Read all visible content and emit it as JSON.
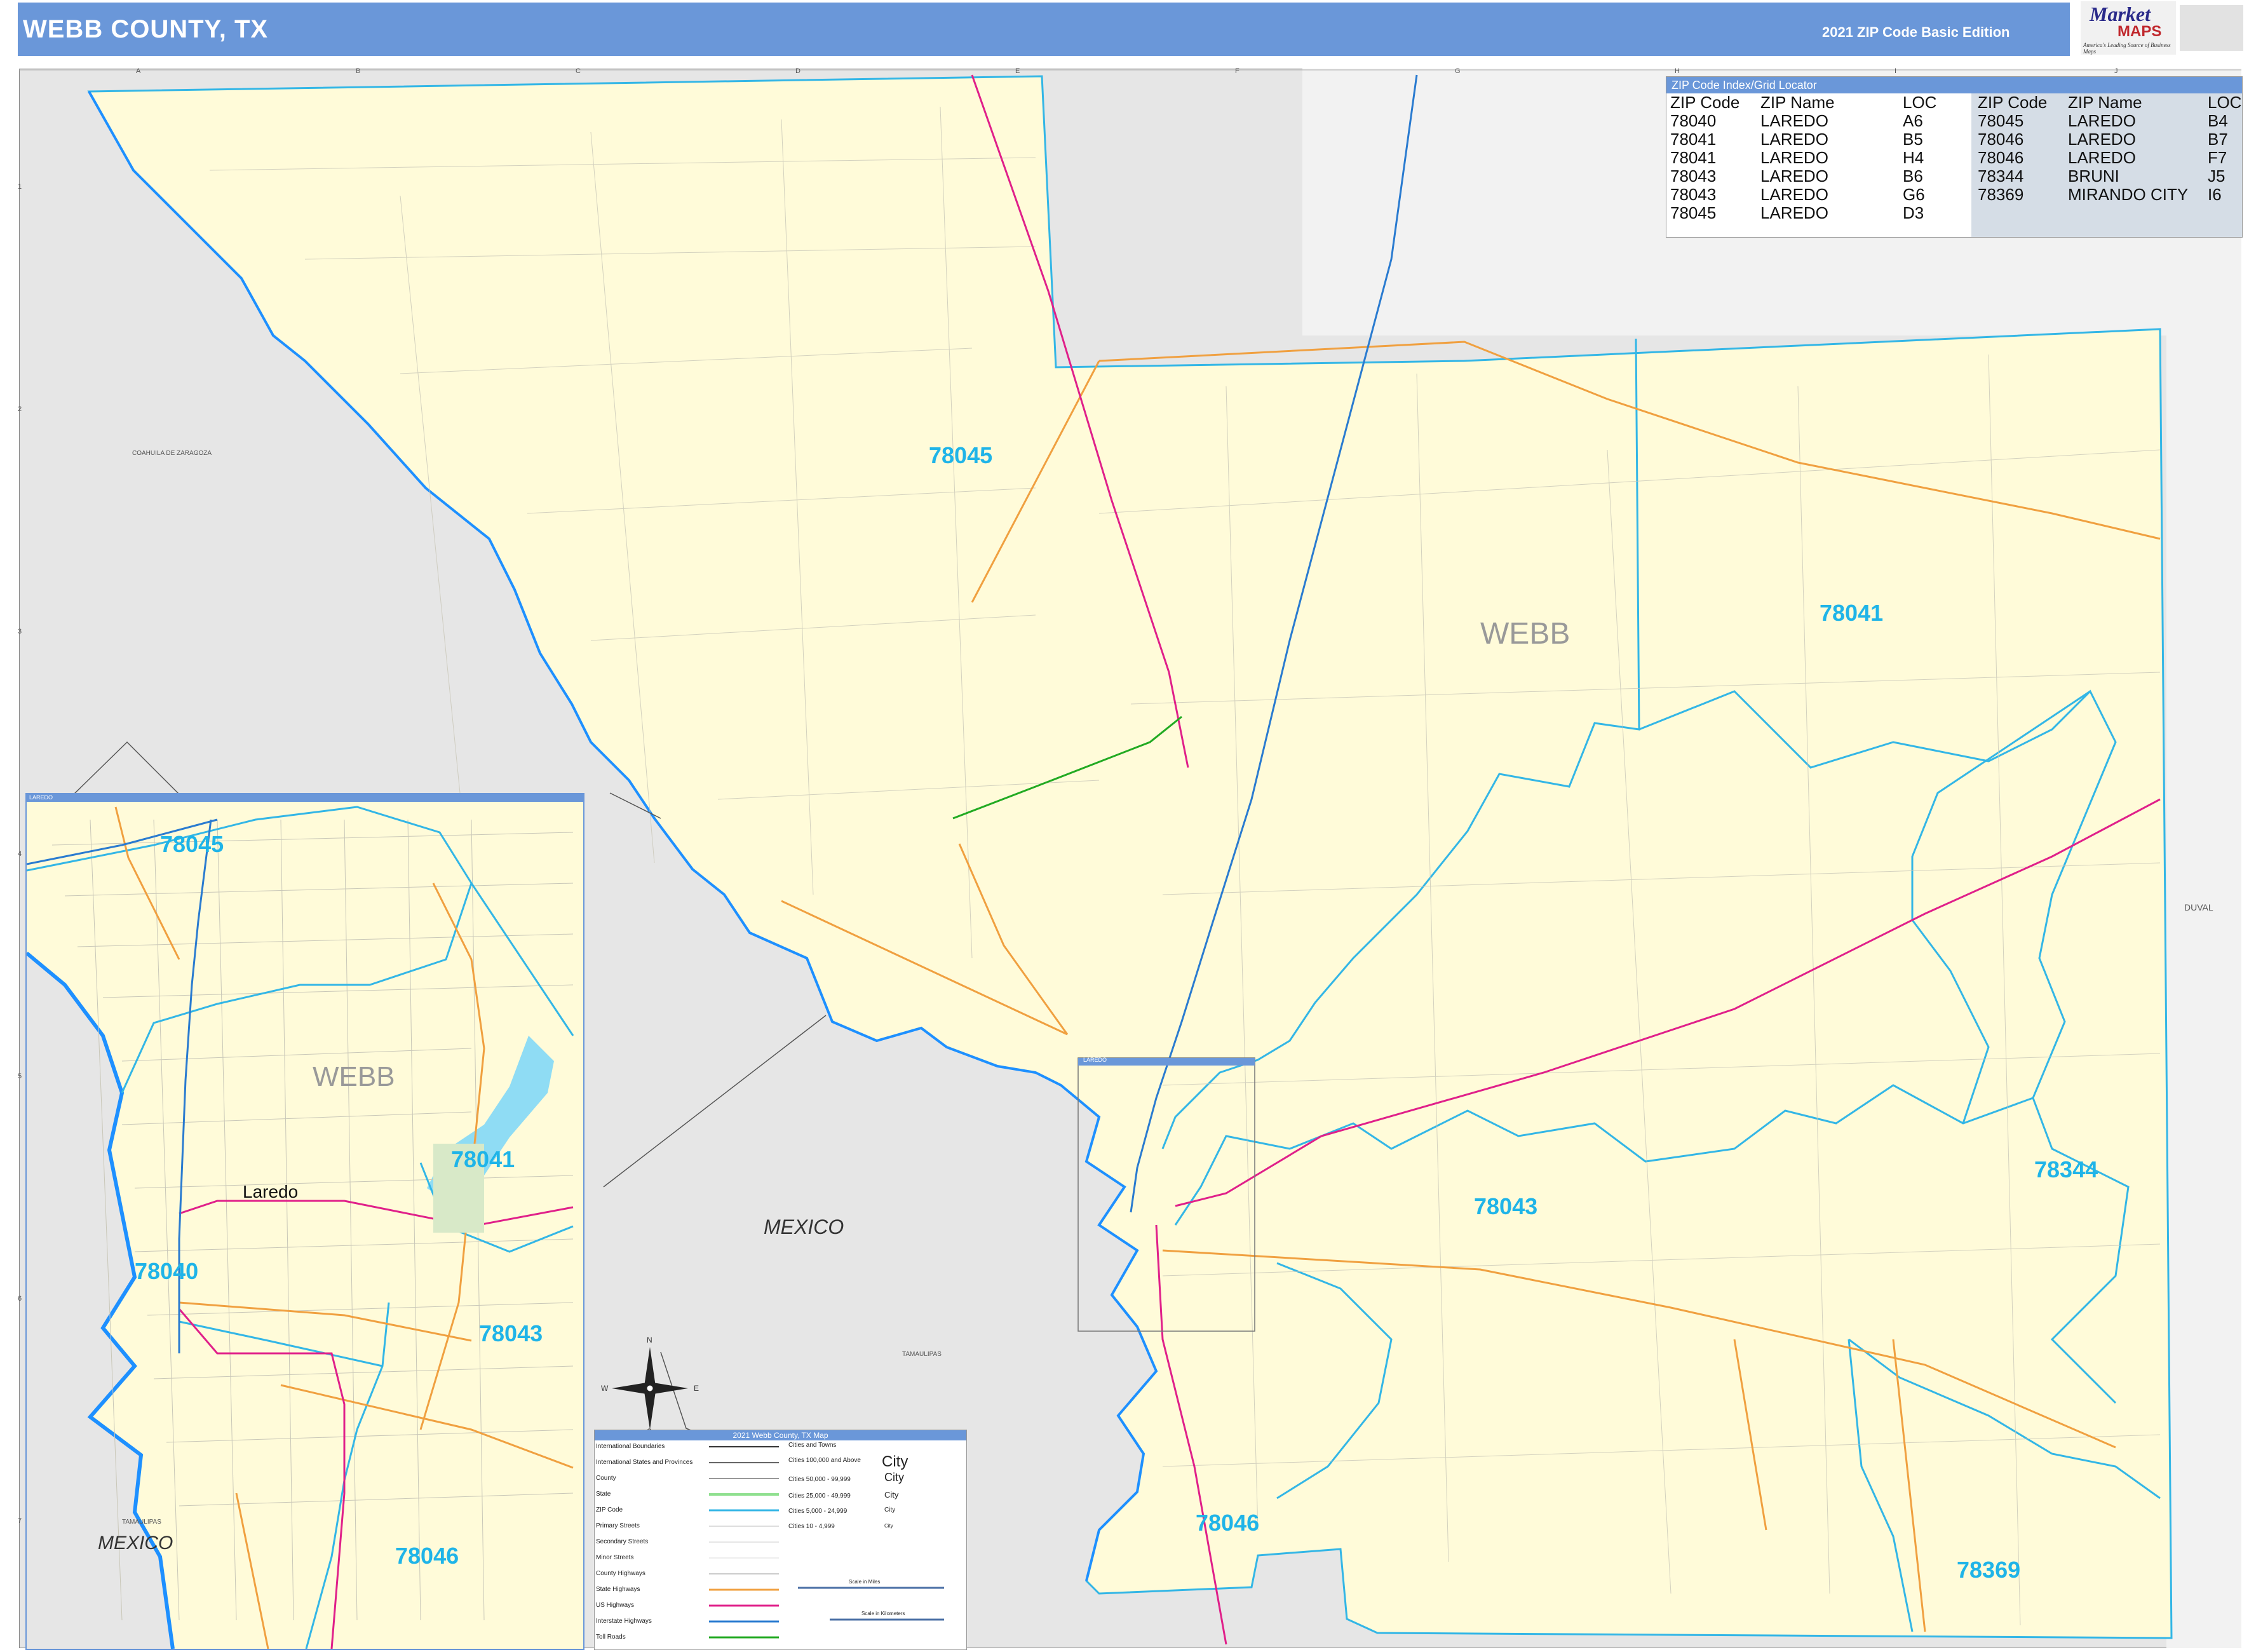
{
  "header": {
    "title": "WEBB COUNTY, TX",
    "edition": "2021 ZIP Code Basic Edition"
  },
  "logo": {
    "line1": "Market",
    "line2": "MAPS",
    "tagline": "America's Leading Source of Business Maps"
  },
  "grid": {
    "columns": [
      "A",
      "B",
      "C",
      "D",
      "E",
      "F",
      "G",
      "H",
      "I",
      "J"
    ],
    "rows": [
      "1",
      "2",
      "3",
      "4",
      "5",
      "6",
      "7"
    ]
  },
  "main_map": {
    "county_label": "WEBB",
    "country_label": "MEXICO",
    "neighbor_labels": {
      "coahuila": "COAHUILA DE ZARAGOZA",
      "tamaulipas": "TAMAULIPAS",
      "duval": "DUVAL"
    },
    "zip_labels": [
      "78045",
      "78041",
      "78043",
      "78344",
      "78046",
      "78369"
    ]
  },
  "zip_index": {
    "title": "ZIP Code Index/Grid Locator",
    "headers": [
      "ZIP Code",
      "ZIP Name",
      "LOC",
      "ZIP Code",
      "ZIP Name",
      "LOC"
    ],
    "rows": [
      [
        "78040",
        "LAREDO",
        "A6",
        "78045",
        "LAREDO",
        "B4"
      ],
      [
        "78041",
        "LAREDO",
        "B5",
        "78046",
        "LAREDO",
        "B7"
      ],
      [
        "78041",
        "LAREDO",
        "H4",
        "78046",
        "LAREDO",
        "F7"
      ],
      [
        "78043",
        "LAREDO",
        "B6",
        "78344",
        "BRUNI",
        "J5"
      ],
      [
        "78043",
        "LAREDO",
        "G6",
        "78369",
        "MIRANDO CITY",
        "I6"
      ],
      [
        "78045",
        "LAREDO",
        "D3",
        "",
        "",
        ""
      ]
    ]
  },
  "inset": {
    "header": "LAREDO",
    "county_label": "WEBB",
    "city_label": "Laredo",
    "country_label": "MEXICO",
    "region_label": "TAMAULIPAS",
    "zip_labels": [
      "78045",
      "78041",
      "78040",
      "78043",
      "78046"
    ]
  },
  "main_inset_box_label": "LAREDO",
  "compass": {
    "n": "N",
    "s": "S",
    "e": "E",
    "w": "W"
  },
  "legend": {
    "title": "2021 Webb County, TX Map",
    "left": [
      "International Boundaries",
      "International States and Provinces",
      "County",
      "State",
      "ZIP Code",
      "Primary Streets",
      "Secondary Streets",
      "Minor Streets",
      "County Highways",
      "State Highways",
      "US Highways",
      "Interstate Highways",
      "Toll Roads"
    ],
    "right": [
      "Cities and Towns",
      "Cities 100,000 and Above",
      "Cities 50,000 - 99,999",
      "Cities 25,000 - 49,999",
      "Cities 5,000 - 24,999",
      "Cities 10 - 4,999"
    ],
    "city_samples": [
      "City",
      "City",
      "City",
      "City",
      "City"
    ],
    "scale_miles": "Scale in Miles",
    "scale_km": "Scale in Kilometers"
  },
  "colors": {
    "header": "#6a97d9",
    "county_fill": "#fffbd9",
    "outside_fill": "#e6e6e6",
    "zip_boundary": "#33b6e6",
    "zip_label": "#1fb4e8",
    "state_highway": "#f0a040",
    "us_highway": "#e0208a",
    "interstate": "#2a7bd0",
    "toll_road": "#22aa22",
    "river": "#1e90ff"
  }
}
